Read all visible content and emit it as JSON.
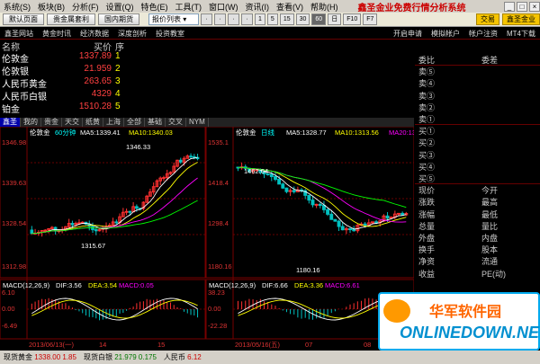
{
  "menu": [
    "系统(S)",
    "板块(B)",
    "分析(F)",
    "设置(Q)",
    "特色(E)",
    "工具(T)",
    "窗口(W)",
    "资讯(I)",
    "查看(V)",
    "帮助(H)"
  ],
  "app_title": "鑫圣金业免费行情分析系统",
  "toolbar": {
    "buttons": [
      "默认页面",
      "贵金属套利",
      "国内期货"
    ],
    "select": "报价列表",
    "periods": [
      "1",
      "5",
      "15",
      "30",
      "60",
      "日"
    ],
    "active_period": "60",
    "extra_btns": [
      "F10",
      "F7"
    ],
    "trade": "交易",
    "brand_btn": "鑫圣金业"
  },
  "links": {
    "left": [
      "鑫圣网站",
      "黄金时讯",
      "经济数据",
      "深度剖析",
      "投资教室"
    ],
    "right": [
      "开启申请",
      "模拟帐户",
      "帐户注资",
      "MT4下载"
    ]
  },
  "quote_header": {
    "name": "名称",
    "price": "买价",
    "seq": "序"
  },
  "quotes": [
    {
      "name": "伦敦金",
      "price": "1337.89",
      "seq": "1",
      "color": "#ff4040"
    },
    {
      "name": "伦敦银",
      "price": "21.959",
      "seq": "2",
      "color": "#ff4040"
    },
    {
      "name": "人民币黄金",
      "price": "263.65",
      "seq": "3",
      "color": "#ff4040"
    },
    {
      "name": "人民币白银",
      "price": "4329",
      "seq": "4",
      "color": "#ff4040"
    },
    {
      "name": "铂金",
      "price": "1510.28",
      "seq": "5",
      "color": "#ff4040"
    }
  ],
  "tabs": [
    "鑫圣",
    "我的",
    "贵金",
    "天交",
    "纸黄",
    "上海",
    "全部",
    "基础",
    "交叉",
    "NYM"
  ],
  "active_tab": "鑫圣",
  "chart_left": {
    "name": "伦敦金",
    "period": "60分钟",
    "ma5": "MA5:1339.41",
    "ma10": "MA10:1340.03",
    "ticks": [
      "1346.98",
      "1339.63",
      "1328.54",
      "1312.98"
    ],
    "high_label": "1346.33",
    "low_label": "1315.67",
    "macd_title": "MACD(12,26,9)",
    "dif": "DIF:3.56",
    "dea": "DEA:3.54",
    "macd": "MACD:0.05",
    "macd_ticks": [
      "6.10",
      "0.00",
      "-6.49"
    ],
    "dates": [
      "2013/06/13(一)",
      "14",
      "15"
    ]
  },
  "chart_right": {
    "name": "伦敦金",
    "period": "日线",
    "ma5": "MA5:1328.77",
    "ma10": "MA10:1313.56",
    "ma20": "MA20:1318.56",
    "ticks": [
      "1535.1",
      "1418.4",
      "1298.4",
      "1180.16"
    ],
    "high_label": "1462.04",
    "low_label": "1180.16",
    "macd_title": "MACD(12,26,9)",
    "dif": "DIF:6.66",
    "dea": "DEA:3.36",
    "macd": "MACD:6.61",
    "macd_ticks": [
      "38.23",
      "0.00",
      "-22.28"
    ],
    "dates": [
      "2013/05/16(五)",
      "07",
      "08"
    ]
  },
  "side_rows": [
    [
      "委比",
      "委差"
    ],
    [
      "卖⑤",
      ""
    ],
    [
      "卖④",
      ""
    ],
    [
      "卖③",
      ""
    ],
    [
      "卖②",
      ""
    ],
    [
      "卖①",
      ""
    ],
    [
      "买①",
      ""
    ],
    [
      "买②",
      ""
    ],
    [
      "买③",
      ""
    ],
    [
      "买④",
      ""
    ],
    [
      "买⑤",
      ""
    ],
    [
      "现价",
      "今开"
    ],
    [
      "涨跌",
      "最高"
    ],
    [
      "涨幅",
      "最低"
    ],
    [
      "总量",
      "量比"
    ],
    [
      "外盘",
      "内盘"
    ],
    [
      "换手",
      "股本"
    ],
    [
      "净资",
      "流通"
    ],
    [
      "收益",
      "PE(动)"
    ]
  ],
  "status": [
    {
      "label": "现货黄金",
      "value": "1338.00",
      "chg": "1.85",
      "cls": "up"
    },
    {
      "label": "现货白银",
      "value": "21.979",
      "chg": "0.175",
      "cls": "down"
    },
    {
      "label": "人民币",
      "value": "6.12",
      "chg": "",
      "cls": "up"
    }
  ],
  "watermark": {
    "line1": "华军软件园",
    "line2": "ONLINEDOWN.NET"
  },
  "colors": {
    "up": "#ff3030",
    "down": "#00c0c0",
    "ma5": "#ffffff",
    "ma10": "#ffff00",
    "ma20": "#ff00ff",
    "ma30": "#00ff00"
  }
}
